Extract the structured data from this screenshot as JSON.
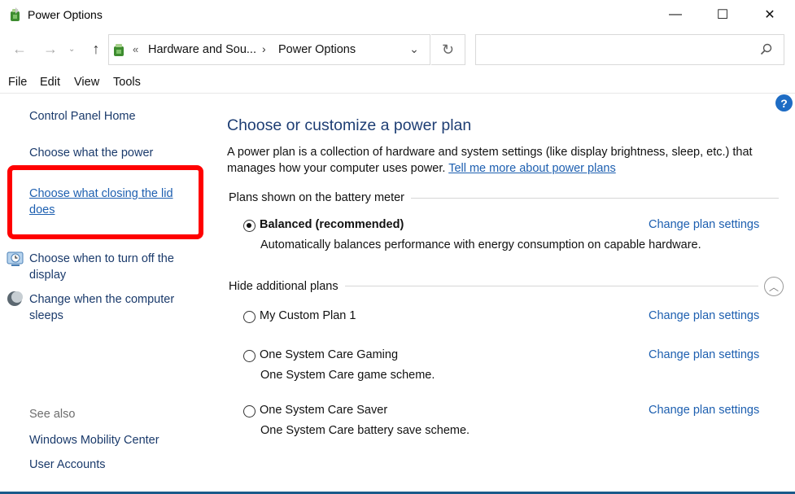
{
  "window": {
    "title": "Power Options",
    "minimize_glyph": "—",
    "maximize_glyph": "☐",
    "close_glyph": "✕"
  },
  "address_bar": {
    "chevron": "«",
    "crumbs": [
      "Hardware and Sou...",
      "Power Options"
    ],
    "separator": "›",
    "search_value": ""
  },
  "menu": [
    "File",
    "Edit",
    "View",
    "Tools"
  ],
  "left_nav": {
    "home": "Control Panel Home",
    "power_buttons": "Choose what the power",
    "lid": "Choose what closing the lid does",
    "display": "Choose when to turn off the display",
    "sleep": "Change when the computer sleeps",
    "see_also": "See also",
    "mobility": "Windows Mobility Center",
    "accounts": "User Accounts"
  },
  "main": {
    "title": "Choose or customize a power plan",
    "description": "A power plan is a collection of hardware and system settings (like display brightness, sleep, etc.) that manages how your computer uses power.",
    "learn_more": "Tell me more about power plans",
    "section_battery": "Plans shown on the battery meter",
    "section_hidden": "Hide additional plans",
    "change_label": "Change plan settings",
    "plans": [
      {
        "name": "Balanced (recommended)",
        "desc": "Automatically balances performance with energy consumption on capable hardware.",
        "selected": true
      },
      {
        "name": "My Custom Plan 1",
        "desc": "",
        "selected": false
      },
      {
        "name": "One System Care Gaming",
        "desc": "One System Care game scheme.",
        "selected": false
      },
      {
        "name": "One System Care Saver",
        "desc": "One System Care battery save scheme.",
        "selected": false
      }
    ]
  },
  "help_glyph": "?",
  "colors": {
    "link": "#1d5fb0",
    "title": "#1e3e74",
    "highlight": "#ff0000"
  }
}
